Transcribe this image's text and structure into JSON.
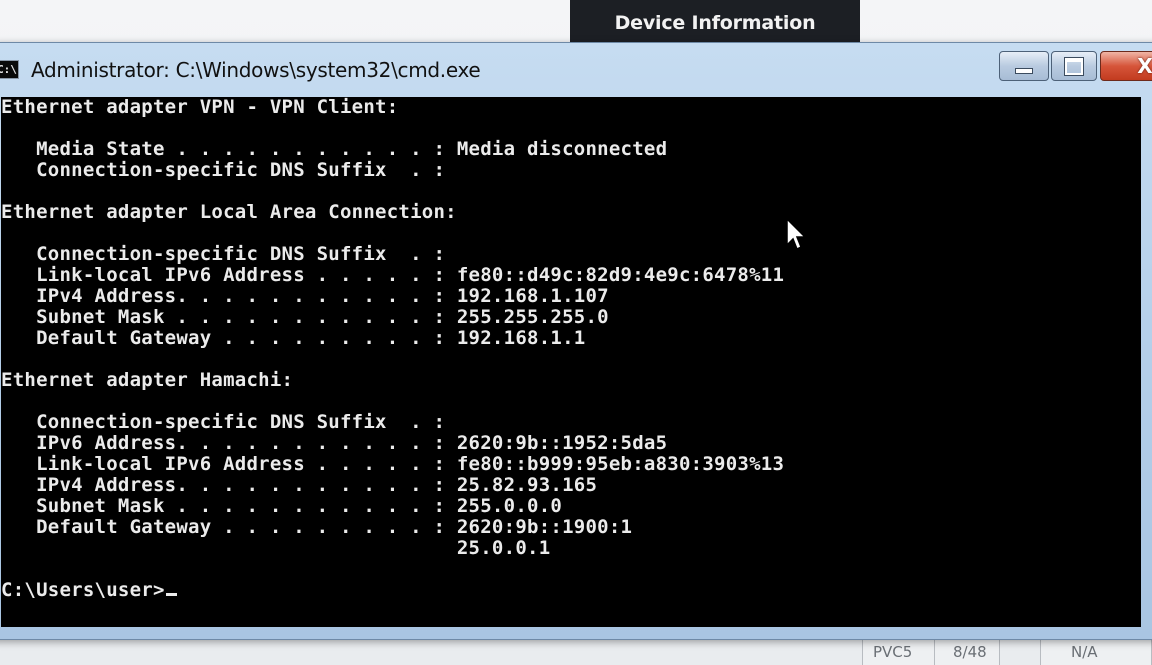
{
  "background": {
    "dialog_title": "Device Information",
    "status_cells": [
      "PVC5",
      "8/48",
      "N/A"
    ]
  },
  "window": {
    "title": "Administrator: C:\\Windows\\system32\\cmd.exe",
    "icon_text": "C:\\",
    "close_glyph": "X"
  },
  "console": {
    "lines": [
      "Ethernet adapter VPN - VPN Client:",
      "",
      "   Media State . . . . . . . . . . . : Media disconnected",
      "   Connection-specific DNS Suffix  . :",
      "",
      "Ethernet adapter Local Area Connection:",
      "",
      "   Connection-specific DNS Suffix  . :",
      "   Link-local IPv6 Address . . . . . : fe80::d49c:82d9:4e9c:6478%11",
      "   IPv4 Address. . . . . . . . . . . : 192.168.1.107",
      "   Subnet Mask . . . . . . . . . . . : 255.255.255.0",
      "   Default Gateway . . . . . . . . . : 192.168.1.1",
      "",
      "Ethernet adapter Hamachi:",
      "",
      "   Connection-specific DNS Suffix  . :",
      "   IPv6 Address. . . . . . . . . . . : 2620:9b::1952:5da5",
      "   Link-local IPv6 Address . . . . . : fe80::b999:95eb:a830:3903%13",
      "   IPv4 Address. . . . . . . . . . . : 25.82.93.165",
      "   Subnet Mask . . . . . . . . . . . : 255.0.0.0",
      "   Default Gateway . . . . . . . . . : 2620:9b::1900:1",
      "                                       25.0.0.1",
      "",
      "C:\\Users\\user>"
    ]
  }
}
